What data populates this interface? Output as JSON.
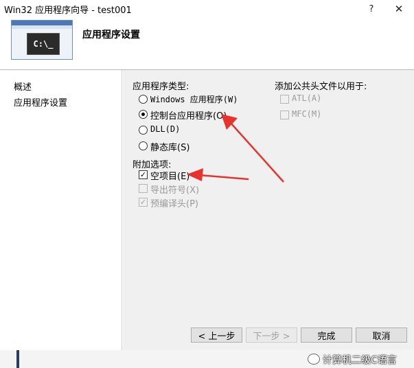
{
  "window": {
    "title": "Win32 应用程序向导 - test001",
    "help_glyph": "?",
    "close_glyph": "✕"
  },
  "header": {
    "page_title": "应用程序设置",
    "icon_console_text": "C:\\_"
  },
  "nav": {
    "items": [
      {
        "label": "概述"
      },
      {
        "label": "应用程序设置"
      }
    ]
  },
  "app_type": {
    "label": "应用程序类型:",
    "options": [
      {
        "label": "Windows 应用程序(W)",
        "checked": false
      },
      {
        "label": "控制台应用程序(O)",
        "checked": true
      },
      {
        "label": "DLL(D)",
        "checked": false
      },
      {
        "label": "静态库(S)",
        "checked": false
      }
    ]
  },
  "common_headers": {
    "label": "添加公共头文件以用于:",
    "options": [
      {
        "label": "ATL(A)",
        "checked": false,
        "enabled": false
      },
      {
        "label": "MFC(M)",
        "checked": false,
        "enabled": false
      }
    ]
  },
  "extra_options": {
    "label": "附加选项:",
    "options": [
      {
        "label": "空项目(E)",
        "checked": true,
        "enabled": true
      },
      {
        "label": "导出符号(X)",
        "checked": false,
        "enabled": false
      },
      {
        "label": "预编译头(P)",
        "checked": true,
        "enabled": false
      }
    ]
  },
  "buttons": {
    "prev": "< 上一步",
    "next": "下一步 >",
    "finish": "完成",
    "cancel": "取消"
  },
  "watermark": {
    "text": "计算机二级C语言"
  },
  "colors": {
    "annotation_arrow": "#e8322c",
    "dialog_bg": "#f0f0f0"
  }
}
